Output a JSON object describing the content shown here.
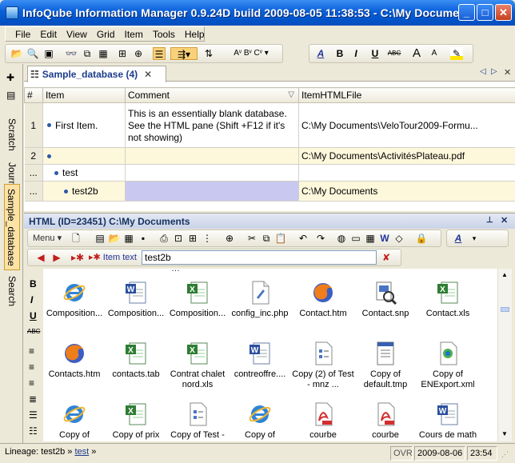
{
  "window": {
    "title": "InfoQube Information Manager 0.9.24D  build 2009-08-05 11:38:53 - C:\\My Docume...",
    "min_label": "_",
    "max_label": "□",
    "close_label": "✕"
  },
  "menu": [
    "File",
    "Edit",
    "View",
    "Grid",
    "Item",
    "Tools",
    "Help"
  ],
  "left_tabs": [
    "Scratch",
    "Journal",
    "Sample_database",
    "Search"
  ],
  "grid_tab": {
    "label": "Sample_database (4)",
    "close": "✕",
    "nav_left": "◁",
    "nav_right": "▷",
    "close_pane": "✕"
  },
  "grid": {
    "columns": [
      "#",
      "Item",
      "Comment",
      "ItemHTMLFile"
    ],
    "comment_filter_icon": "▽",
    "rows": [
      {
        "num": "1",
        "item": "First Item.",
        "comment": "This is an essentially blank database. See the HTML pane (Shift +F12 if it's not showing)",
        "file": "C:\\My Documents\\VeloTour2009-Formu..."
      },
      {
        "num": "2",
        "item": "",
        "comment": "",
        "file": "C:\\My Documents\\ActivitésPlateau.pdf"
      },
      {
        "num": "...",
        "item": "test",
        "comment": "",
        "file": ""
      },
      {
        "num": "...",
        "item": "test2b",
        "comment": "",
        "file": "C:\\My Documents"
      }
    ]
  },
  "html_pane": {
    "title": "HTML (ID=23451) C:\\My Documents",
    "pin": "📌",
    "close": "✕",
    "menu_label": "Menu",
    "item_text_label": "Item text",
    "item_text_value": "test2b"
  },
  "files": [
    {
      "name": "Composition...",
      "type": "ie"
    },
    {
      "name": "Composition...",
      "type": "word"
    },
    {
      "name": "Composition...",
      "type": "excel"
    },
    {
      "name": "config_inc.php",
      "type": "php"
    },
    {
      "name": "Contact.htm",
      "type": "firefox"
    },
    {
      "name": "Contact.snp",
      "type": "snp"
    },
    {
      "name": "Contact.xls",
      "type": "excel"
    },
    {
      "name": "Contacts.htm",
      "type": "firefox"
    },
    {
      "name": "contacts.tab",
      "type": "excel"
    },
    {
      "name": "Contrat chalet nord.xls",
      "type": "excel"
    },
    {
      "name": "contreoffre....",
      "type": "word"
    },
    {
      "name": "Copy (2) of Test - mnz ...",
      "type": "doc"
    },
    {
      "name": "Copy of default.tmp",
      "type": "tmp"
    },
    {
      "name": "Copy of ENExport.xml",
      "type": "xml"
    },
    {
      "name": "Copy of",
      "type": "ie"
    },
    {
      "name": "Copy of prix",
      "type": "excel"
    },
    {
      "name": "Copy of Test -",
      "type": "doc"
    },
    {
      "name": "Copy of",
      "type": "ie"
    },
    {
      "name": "courbe",
      "type": "pdf"
    },
    {
      "name": "courbe",
      "type": "pdf"
    },
    {
      "name": "Cours de math",
      "type": "word"
    }
  ],
  "top_clip_text": "…",
  "status": {
    "lineage_label": "Lineage: test2b »",
    "lineage_link": "test",
    "lineage_end": "»",
    "ovr": "OVR",
    "date": "2009-08-06",
    "time": "23:54"
  },
  "colors": {
    "title_blue": "#0a5fd9",
    "grid_highlight": "#c8c8f0",
    "selected_row": "#fdf8dc",
    "tab_active": "#fbe3a8"
  }
}
